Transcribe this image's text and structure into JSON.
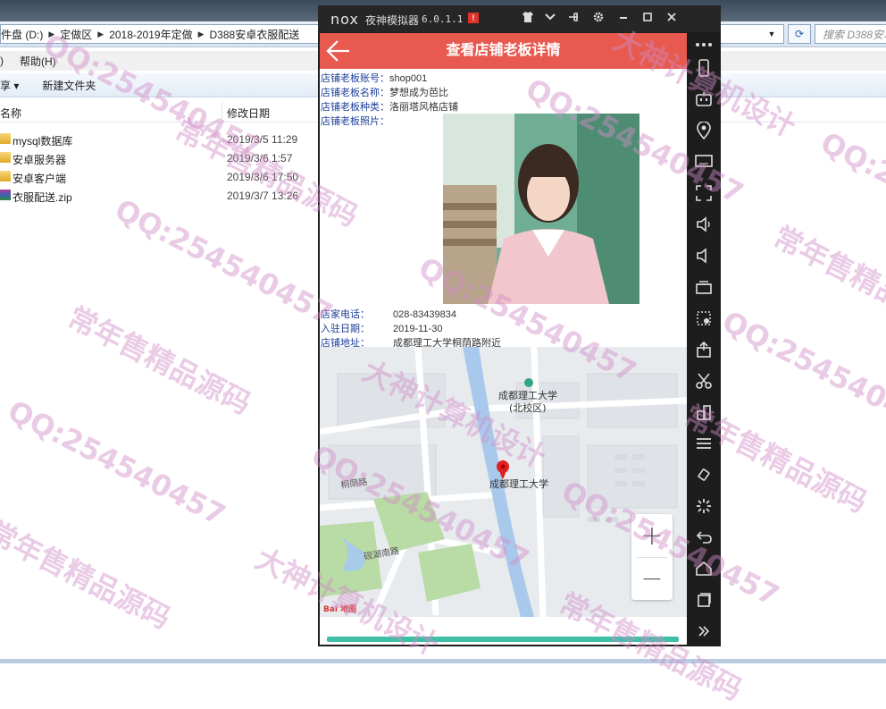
{
  "explorer": {
    "address": [
      "件盘 (D:)",
      "定做区",
      "2018-2019年定做",
      "D388安卓衣服配送"
    ],
    "search_placeholder": "搜索 D388安卓",
    "menu": [
      "帮助(H)"
    ],
    "menu_partial": ")",
    "toolbar": {
      "organize": "享 ▾",
      "new_folder": "新建文件夹"
    },
    "columns": {
      "name": "名称",
      "modified": "修改日期"
    },
    "files": [
      {
        "name": "mysql数据库",
        "date": "2019/3/5 11:29",
        "type": "folder"
      },
      {
        "name": "安卓服务器",
        "date": "2019/3/6 1:57",
        "type": "folder"
      },
      {
        "name": "安卓客户端",
        "date": "2019/3/6 17:50",
        "type": "folder"
      },
      {
        "name": "衣服配送.zip",
        "date": "2019/3/7 13:26",
        "type": "zip"
      }
    ]
  },
  "nox": {
    "logo": "nox",
    "name": "夜神模拟器",
    "version": "6.0.1.1",
    "badge": "!",
    "colors": {
      "appbar": "#e85a4f",
      "label": "#1d3f9a"
    }
  },
  "app": {
    "title": "查看店铺老板详情",
    "fields": [
      {
        "label": "店铺老板账号：",
        "value": "shop001"
      },
      {
        "label": "店铺老板名称：",
        "value": "梦想成为芭比"
      },
      {
        "label": "店铺老板种类：",
        "value": "洛丽塔风格店铺"
      },
      {
        "label": "店铺老板照片：",
        "value": ""
      }
    ],
    "contact": [
      {
        "label": "店家电话：",
        "value": "028-83439834"
      },
      {
        "label": "入驻日期：",
        "value": "2019-11-30"
      },
      {
        "label": "店铺地址：",
        "value": "成都理工大学桐荫路附近"
      }
    ],
    "map": {
      "labels": {
        "campus": "成都理工大学",
        "campus_sub": "(北校区)",
        "pin_label": "成都理工大学",
        "road1": "桐荫路",
        "road2": "砚湖南路",
        "brand": "Bai 地图"
      },
      "zoom_in": "+",
      "zoom_out": "−"
    }
  },
  "watermarks": [
    "QQ:254540457",
    "常年售精品源码",
    "大神计算机设计"
  ]
}
